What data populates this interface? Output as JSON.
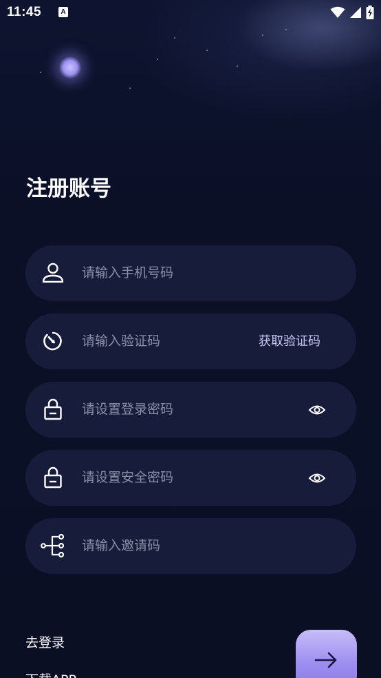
{
  "status_bar": {
    "time": "11:45",
    "notification_icon": "A"
  },
  "page": {
    "title": "注册账号"
  },
  "form": {
    "phone": {
      "placeholder": "请输入手机号码",
      "icon": "user-icon"
    },
    "code": {
      "placeholder": "请输入验证码",
      "icon": "timer-icon",
      "action_label": "获取验证码"
    },
    "login_password": {
      "placeholder": "请设置登录密码",
      "icon": "lock-icon"
    },
    "security_password": {
      "placeholder": "请设置安全密码",
      "icon": "lock-icon"
    },
    "invite_code": {
      "placeholder": "请输入邀请码",
      "icon": "tree-icon"
    }
  },
  "links": {
    "go_login": "去登录",
    "download_app": "下载APP"
  },
  "colors": {
    "background": "#0b1027",
    "field_bg": "#171c3a",
    "accent": "#9c8ef0"
  }
}
